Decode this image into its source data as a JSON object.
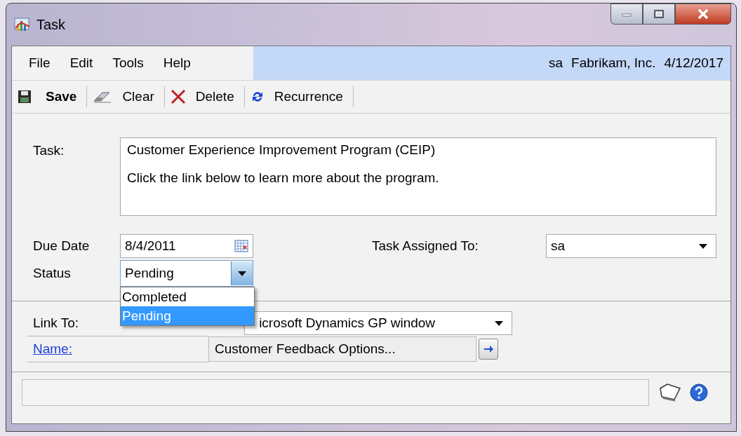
{
  "window": {
    "title": "Task"
  },
  "menu": [
    {
      "label": "File"
    },
    {
      "label": "Edit"
    },
    {
      "label": "Tools"
    },
    {
      "label": "Help"
    }
  ],
  "session": {
    "user": "sa",
    "company": "Fabrikam, Inc.",
    "date": "4/12/2017"
  },
  "toolbar": [
    {
      "label": "Save",
      "kind": "save"
    },
    {
      "label": "Clear",
      "kind": "clear"
    },
    {
      "label": "Delete",
      "kind": "delete"
    },
    {
      "label": "Recurrence",
      "kind": "recurrence"
    }
  ],
  "task": {
    "label": "Task:",
    "lines": [
      "Customer Experience Improvement Program (CEIP)",
      "Click the link below to learn more about the program."
    ]
  },
  "due_date": {
    "label": "Due Date",
    "value": "8/4/2011"
  },
  "assigned_to": {
    "label": "Task Assigned To:",
    "value": "sa"
  },
  "status": {
    "label": "Status",
    "value": "Pending",
    "expanded": true,
    "options": [
      {
        "label": "Completed",
        "selected": false
      },
      {
        "label": "Pending",
        "selected": true
      }
    ]
  },
  "link_to": {
    "label": "Link To:",
    "value": "icrosoft Dynamics GP window"
  },
  "name": {
    "label": "Name:",
    "value": "Customer Feedback Options..."
  }
}
